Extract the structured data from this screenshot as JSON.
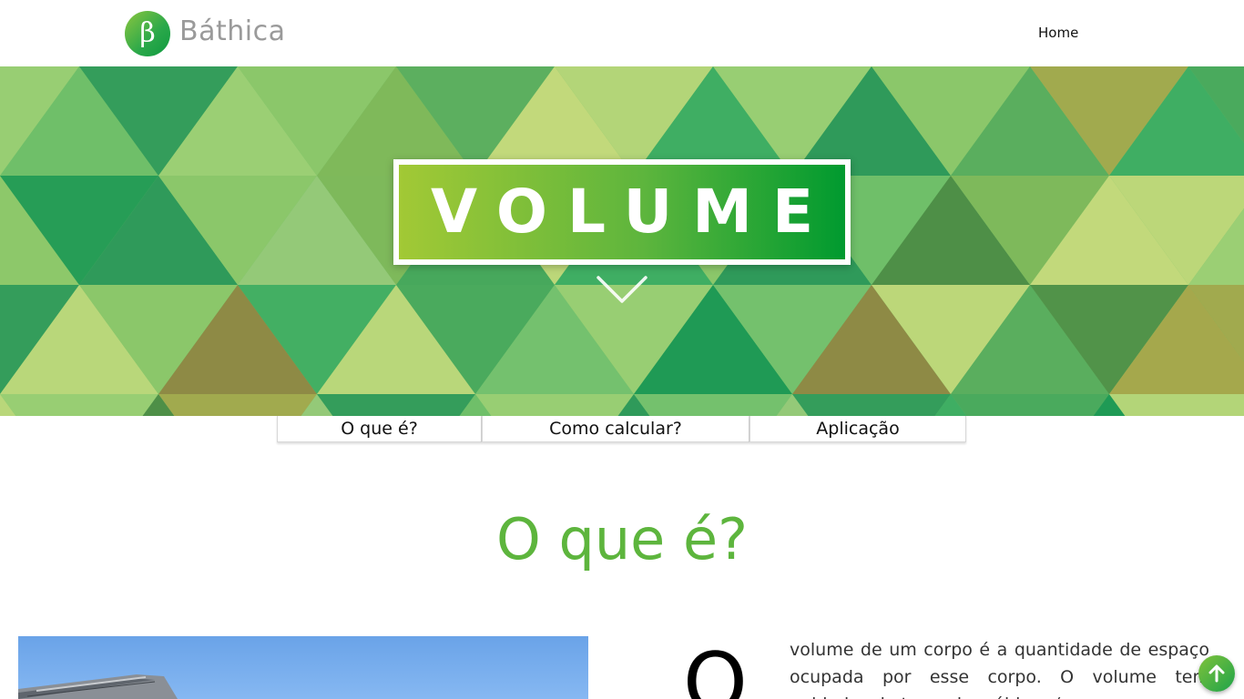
{
  "header": {
    "logo_glyph": "β",
    "brand": "Báthica",
    "nav": {
      "home": "Home"
    }
  },
  "hero": {
    "title": "VOLUME",
    "scroll_icon": "chevron-down-icon",
    "colors": {
      "title_gradient_start": "#a2c935",
      "title_gradient_end": "#009a2f"
    }
  },
  "tabs": [
    {
      "label": "O que é?"
    },
    {
      "label": "Como calcular?"
    },
    {
      "label": "Aplicação"
    }
  ],
  "section": {
    "title": "O que é?",
    "dropcap": "O",
    "text": "volume de um corpo é a quantidade de espaço ocupada por esse corpo. O volume tem unidades de tamanho cúbicas (",
    "accent_color": "#5db53d"
  },
  "back_to_top": {
    "icon": "arrow-up-icon"
  }
}
